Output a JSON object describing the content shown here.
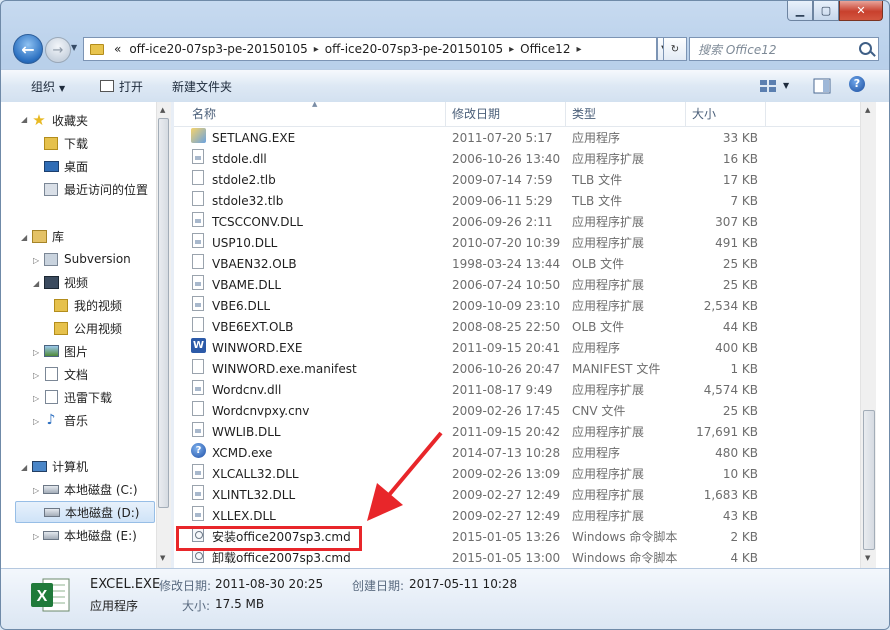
{
  "window": {
    "min_label": "▁",
    "max_label": "▢",
    "close_label": "✕"
  },
  "address": {
    "overflow": "«",
    "crumbs": [
      "off-ice20-07sp3-pe-20150105",
      "off-ice20-07sp3-pe-20150105",
      "Office12"
    ],
    "sep": "▸",
    "dropdown": "▼",
    "refresh": "↻"
  },
  "search": {
    "placeholder": "搜索 Office12"
  },
  "toolbar": {
    "organize": "组织",
    "open": "打开",
    "new_folder": "新建文件夹",
    "help": "?"
  },
  "nav": {
    "favorites": "收藏夹",
    "downloads": "下载",
    "desktop": "桌面",
    "recent": "最近访问的位置",
    "libraries": "库",
    "subversion": "Subversion",
    "videos": "视频",
    "my_videos": "我的视频",
    "public_videos": "公用视频",
    "pictures": "图片",
    "documents": "文档",
    "thunder": "迅雷下载",
    "music": "音乐",
    "computer": "计算机",
    "drive_c": "本地磁盘 (C:)",
    "drive_d": "本地磁盘 (D:)",
    "drive_e": "本地磁盘 (E:)"
  },
  "columns": {
    "name": "名称",
    "date": "修改日期",
    "type": "类型",
    "size": "大小"
  },
  "files": [
    {
      "name": "SETLANG.EXE",
      "date": "2011-07-20 5:17",
      "type": "应用程序",
      "size": "33 KB",
      "icon": "setlang-icon"
    },
    {
      "name": "stdole.dll",
      "date": "2006-10-26 13:40",
      "type": "应用程序扩展",
      "size": "16 KB",
      "icon": "dll-icon"
    },
    {
      "name": "stdole2.tlb",
      "date": "2009-07-14 7:59",
      "type": "TLB 文件",
      "size": "17 KB",
      "icon": "file-icon"
    },
    {
      "name": "stdole32.tlb",
      "date": "2009-06-11 5:29",
      "type": "TLB 文件",
      "size": "7 KB",
      "icon": "file-icon"
    },
    {
      "name": "TCSCCONV.DLL",
      "date": "2006-09-26 2:11",
      "type": "应用程序扩展",
      "size": "307 KB",
      "icon": "dll-icon"
    },
    {
      "name": "USP10.DLL",
      "date": "2010-07-20 10:39",
      "type": "应用程序扩展",
      "size": "491 KB",
      "icon": "dll-icon"
    },
    {
      "name": "VBAEN32.OLB",
      "date": "1998-03-24 13:44",
      "type": "OLB 文件",
      "size": "25 KB",
      "icon": "file-icon"
    },
    {
      "name": "VBAME.DLL",
      "date": "2006-07-24 10:50",
      "type": "应用程序扩展",
      "size": "25 KB",
      "icon": "dll-icon"
    },
    {
      "name": "VBE6.DLL",
      "date": "2009-10-09 23:10",
      "type": "应用程序扩展",
      "size": "2,534 KB",
      "icon": "dll-icon"
    },
    {
      "name": "VBE6EXT.OLB",
      "date": "2008-08-25 22:50",
      "type": "OLB 文件",
      "size": "44 KB",
      "icon": "file-icon"
    },
    {
      "name": "WINWORD.EXE",
      "date": "2011-09-15 20:41",
      "type": "应用程序",
      "size": "400 KB",
      "icon": "word-icon"
    },
    {
      "name": "WINWORD.exe.manifest",
      "date": "2006-10-26 20:47",
      "type": "MANIFEST 文件",
      "size": "1 KB",
      "icon": "file-icon"
    },
    {
      "name": "Wordcnv.dll",
      "date": "2011-08-17 9:49",
      "type": "应用程序扩展",
      "size": "4,574 KB",
      "icon": "dll-icon"
    },
    {
      "name": "Wordcnvpxy.cnv",
      "date": "2009-02-26 17:45",
      "type": "CNV 文件",
      "size": "25 KB",
      "icon": "file-icon"
    },
    {
      "name": "WWLIB.DLL",
      "date": "2011-09-15 20:42",
      "type": "应用程序扩展",
      "size": "17,691 KB",
      "icon": "dll-icon"
    },
    {
      "name": "XCMD.exe",
      "date": "2014-07-13 10:28",
      "type": "应用程序",
      "size": "480 KB",
      "icon": "help-icon"
    },
    {
      "name": "XLCALL32.DLL",
      "date": "2009-02-26 13:09",
      "type": "应用程序扩展",
      "size": "10 KB",
      "icon": "dll-icon"
    },
    {
      "name": "XLINTL32.DLL",
      "date": "2009-02-27 12:49",
      "type": "应用程序扩展",
      "size": "1,683 KB",
      "icon": "dll-icon"
    },
    {
      "name": "XLLEX.DLL",
      "date": "2009-02-27 12:49",
      "type": "应用程序扩展",
      "size": "43 KB",
      "icon": "dll-icon"
    },
    {
      "name": "安装office2007sp3.cmd",
      "date": "2015-01-05 13:26",
      "type": "Windows 命令脚本",
      "size": "2 KB",
      "icon": "cmd-icon"
    },
    {
      "name": "卸载office2007sp3.cmd",
      "date": "2015-01-05 13:00",
      "type": "Windows 命令脚本",
      "size": "4 KB",
      "icon": "cmd-icon"
    }
  ],
  "details": {
    "filename": "EXCEL.EXE",
    "filetype": "应用程序",
    "modified_label": "修改日期:",
    "modified_value": "2011-08-30 20:25",
    "created_label": "创建日期:",
    "created_value": "2017-05-11 10:28",
    "size_label": "大小:",
    "size_value": "17.5 MB"
  },
  "colors": {
    "highlight": "#e8262a",
    "arrow": "#e8262a",
    "excel_green": "#1f7a3a"
  }
}
